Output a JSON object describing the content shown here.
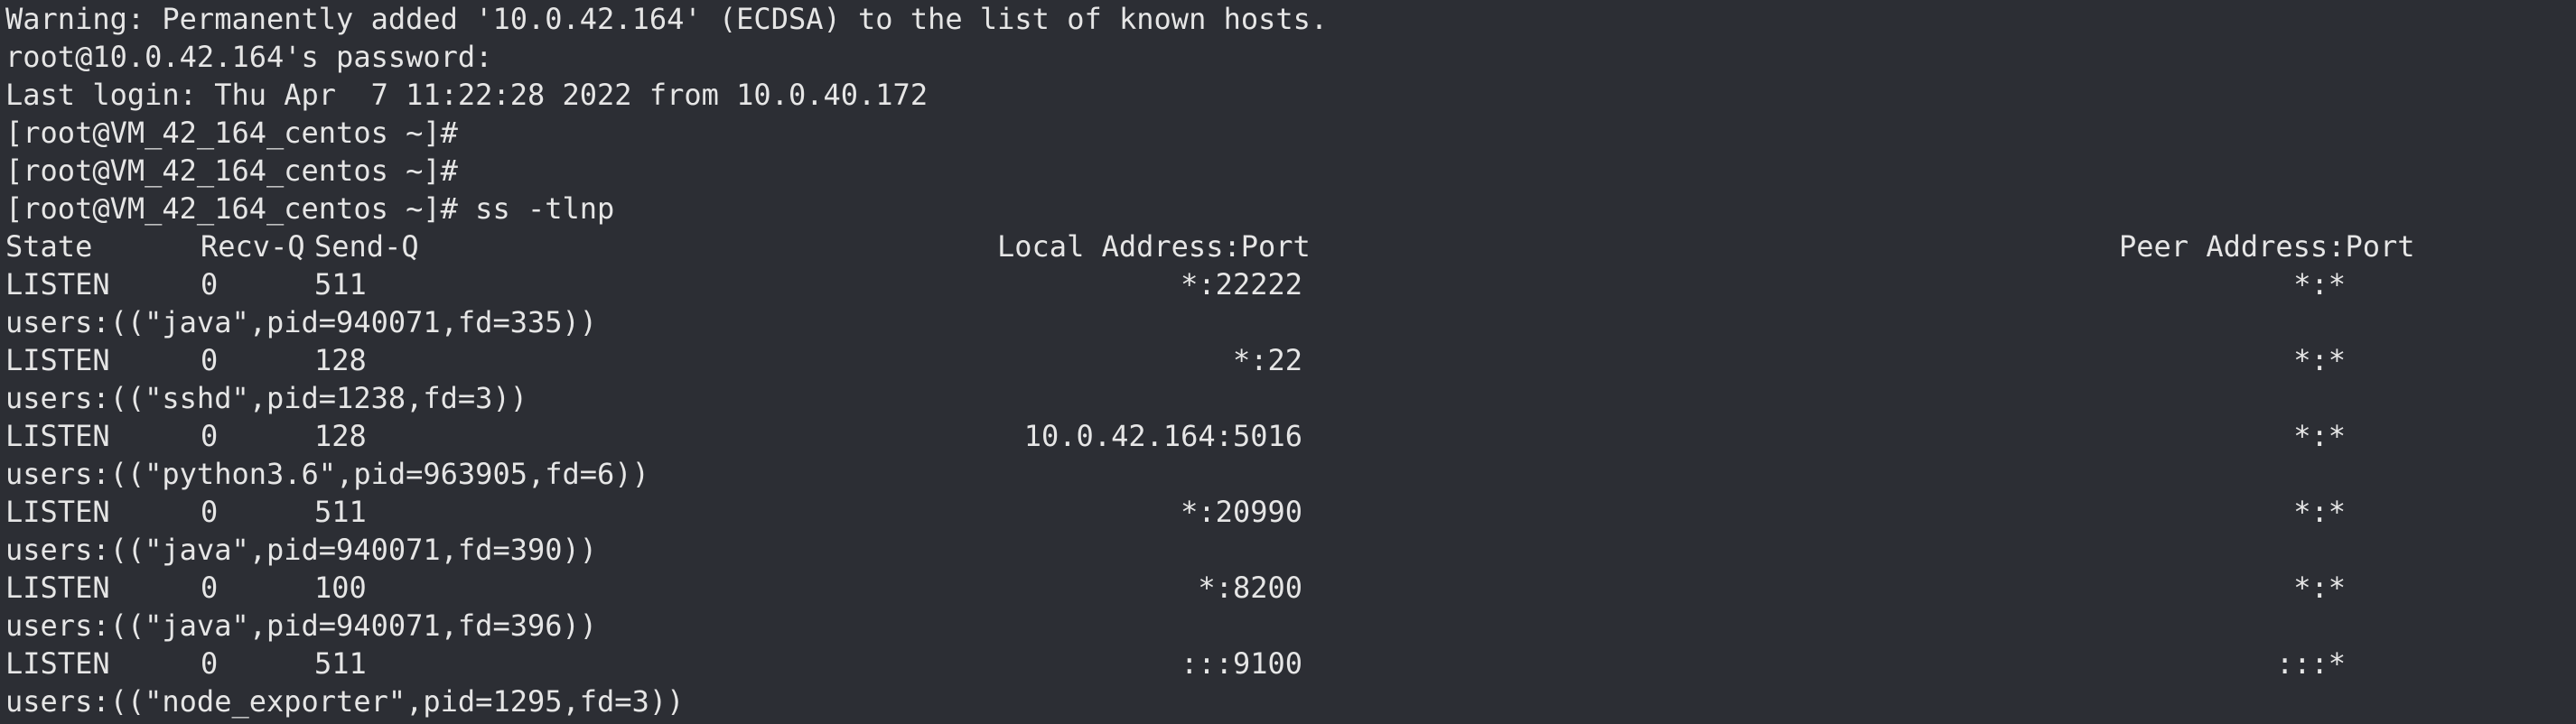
{
  "session": {
    "warning": "Warning: Permanently added '10.0.42.164' (ECDSA) to the list of known hosts.",
    "password_prompt": "root@10.0.42.164's password:",
    "last_login": "Last login: Thu Apr  7 11:22:28 2022 from 10.0.40.172",
    "prompt": "[root@VM_42_164_centos ~]#",
    "command": "ss -tlnp"
  },
  "table": {
    "headers": {
      "state": "State",
      "recv_q": "Recv-Q",
      "send_q": "Send-Q",
      "local": "Local Address:Port",
      "peer": "Peer Address:Port"
    },
    "rows": [
      {
        "state": "LISTEN",
        "recv_q": "0",
        "send_q": "511",
        "local": "*:22222",
        "peer": "*:*",
        "users": "users:((\"java\",pid=940071,fd=335))"
      },
      {
        "state": "LISTEN",
        "recv_q": "0",
        "send_q": "128",
        "local": "*:22",
        "peer": "*:*",
        "users": "users:((\"sshd\",pid=1238,fd=3))"
      },
      {
        "state": "LISTEN",
        "recv_q": "0",
        "send_q": "128",
        "local": "10.0.42.164:5016",
        "peer": "*:*",
        "users": "users:((\"python3.6\",pid=963905,fd=6))"
      },
      {
        "state": "LISTEN",
        "recv_q": "0",
        "send_q": "511",
        "local": "*:20990",
        "peer": "*:*",
        "users": "users:((\"java\",pid=940071,fd=390))"
      },
      {
        "state": "LISTEN",
        "recv_q": "0",
        "send_q": "100",
        "local": "*:8200",
        "peer": "*:*",
        "users": "users:((\"java\",pid=940071,fd=396))"
      },
      {
        "state": "LISTEN",
        "recv_q": "0",
        "send_q": "511",
        "local": ":::9100",
        "peer": ":::*",
        "users": "users:((\"node_exporter\",pid=1295,fd=3))"
      }
    ]
  },
  "colors": {
    "background": "#2c2e34",
    "foreground": "#e6e6e6"
  }
}
